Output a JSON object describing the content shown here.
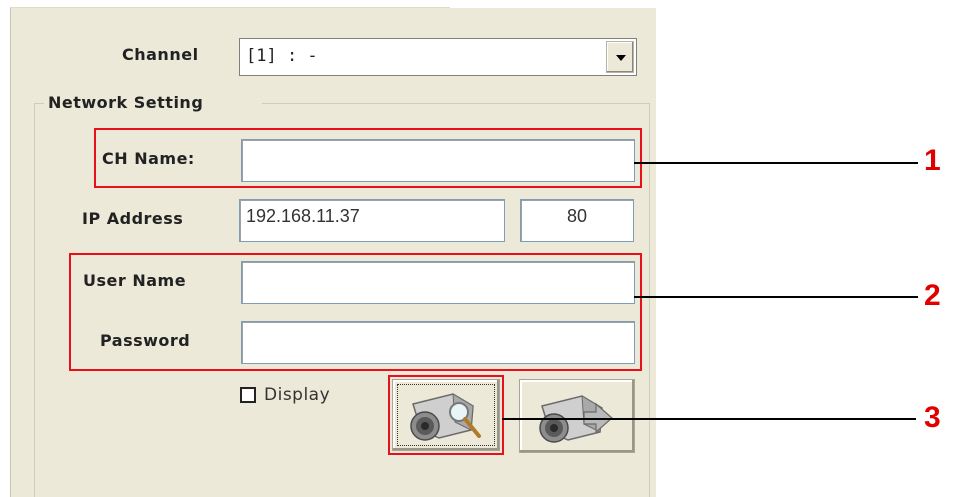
{
  "channel": {
    "label": "Channel",
    "value": "[1] : -"
  },
  "network": {
    "group_title": "Network Setting",
    "ch_name": {
      "label": "CH Name:",
      "value": ""
    },
    "ip": {
      "label": "IP Address",
      "value": "192.168.11.37",
      "port": "80"
    },
    "username": {
      "label": "User Name",
      "value": ""
    },
    "password": {
      "label": "Password",
      "value": ""
    },
    "display": {
      "label": "Display",
      "checked": false
    }
  },
  "buttons": {
    "search_icon": "camera-search-icon",
    "connect_icon": "camera-arrow-icon"
  },
  "callouts": [
    "1",
    "2",
    "3"
  ],
  "colors": {
    "highlight": "#e8101a",
    "callout_number": "#e00000",
    "panel": "#ece9d8"
  }
}
